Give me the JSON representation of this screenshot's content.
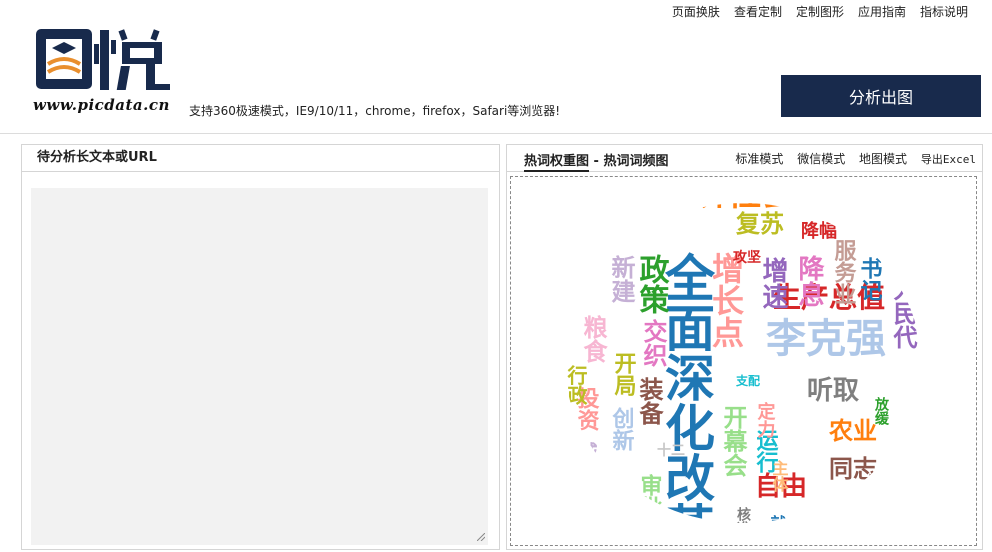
{
  "nav": {
    "items": [
      "页面换肤",
      "查看定制",
      "定制图形",
      "应用指南",
      "指标说明"
    ]
  },
  "logo": {
    "text": "图悦",
    "url": "www.picdata.cn"
  },
  "support_text": "支持360极速模式，IE9/10/11，chrome，firefox，Safari等浏览器!",
  "analyze_button": "分析出图",
  "left_panel": {
    "title": "待分析长文本或URL",
    "textarea_value": ""
  },
  "right_panel": {
    "title_part1": "热词权重图",
    "title_sep": " - ",
    "title_part2": "热词词频图",
    "modes": [
      "标准模式",
      "微信模式",
      "地图模式"
    ],
    "export": "导出Excel"
  },
  "colors": {
    "brand_dark": "#182a4c",
    "logo_orange": "#e98f2e",
    "textarea_bg": "#f2f2f2"
  },
  "cloud_words": [
    {
      "text": "全面深化改革",
      "color": "#1f77b4",
      "vertical": true
    },
    {
      "text": "经济社会发展",
      "color": "#ff7f0e",
      "vertical": false
    },
    {
      "text": "李克强",
      "color": "#aec7e8",
      "vertical": false
    },
    {
      "text": "生产总值",
      "color": "#d62728",
      "vertical": false
    },
    {
      "text": "增长点",
      "color": "#ff9896",
      "vertical": true
    },
    {
      "text": "政策",
      "color": "#2ca02c",
      "vertical": true
    },
    {
      "text": "增速",
      "color": "#9467bd",
      "vertical": true
    },
    {
      "text": "降息",
      "color": "#e377c2",
      "vertical": true
    },
    {
      "text": "服务业",
      "color": "#c49c94",
      "vertical": true
    },
    {
      "text": "复苏",
      "color": "#bcbd22",
      "vertical": false
    },
    {
      "text": "降幅",
      "color": "#d62728",
      "vertical": false
    },
    {
      "text": "听取",
      "color": "#7f7f7f",
      "vertical": false
    },
    {
      "text": "农业",
      "color": "#ff7f0e",
      "vertical": false
    },
    {
      "text": "同志",
      "color": "#8c564b",
      "vertical": false
    },
    {
      "text": "自由",
      "color": "#d62728",
      "vertical": false
    },
    {
      "text": "开幕会",
      "color": "#98df8a",
      "vertical": true
    },
    {
      "text": "运行",
      "color": "#17becf",
      "vertical": true
    },
    {
      "text": "装备",
      "color": "#8c564b",
      "vertical": true
    },
    {
      "text": "交织",
      "color": "#e377c2",
      "vertical": true
    },
    {
      "text": "开局",
      "color": "#bcbd22",
      "vertical": true
    },
    {
      "text": "粮食",
      "color": "#f7b6d2",
      "vertical": true
    },
    {
      "text": "新建",
      "color": "#c5b0d5",
      "vertical": true
    },
    {
      "text": "创新",
      "color": "#aec7e8",
      "vertical": true
    },
    {
      "text": "人民代",
      "color": "#9467bd",
      "vertical": true
    },
    {
      "text": "书记",
      "color": "#1f77b4",
      "vertical": true
    },
    {
      "text": "定力",
      "color": "#ff9896",
      "vertical": true
    },
    {
      "text": "放缓",
      "color": "#2ca02c",
      "vertical": true
    },
    {
      "text": "攻坚",
      "color": "#d62728",
      "vertical": false
    },
    {
      "text": "支配",
      "color": "#17becf",
      "vertical": false
    },
    {
      "text": "投资",
      "color": "#ff9896",
      "vertical": true
    },
    {
      "text": "城乡",
      "color": "#c5b0d5",
      "vertical": true
    },
    {
      "text": "行政",
      "color": "#bcbd22",
      "vertical": true
    },
    {
      "text": "主体",
      "color": "#ffbb78",
      "vertical": true
    },
    {
      "text": "审批",
      "color": "#98df8a",
      "vertical": true
    },
    {
      "text": "就业",
      "color": "#1f77b4",
      "vertical": true
    },
    {
      "text": "核准",
      "color": "#7f7f7f",
      "vertical": true
    },
    {
      "text": "十二",
      "color": "#c7c7c7",
      "vertical": false
    }
  ]
}
